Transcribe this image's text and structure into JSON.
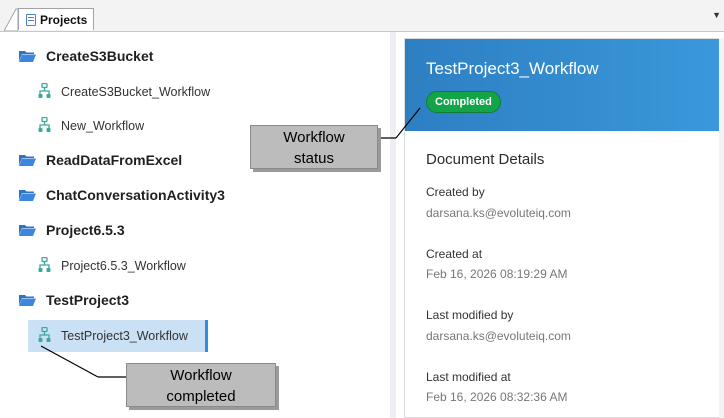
{
  "tabs": [
    {
      "label": "Projects"
    }
  ],
  "tree": {
    "items": [
      {
        "type": "folder",
        "label": "CreateS3Bucket"
      },
      {
        "type": "workflow",
        "label": "CreateS3Bucket_Workflow"
      },
      {
        "type": "workflow",
        "label": "New_Workflow"
      },
      {
        "type": "folder",
        "label": "ReadDataFromExcel"
      },
      {
        "type": "folder",
        "label": "ChatConversationActivity3"
      },
      {
        "type": "folder",
        "label": "Project6.5.3"
      },
      {
        "type": "workflow",
        "label": "Project6.5.3_Workflow"
      },
      {
        "type": "folder",
        "label": "TestProject3"
      },
      {
        "type": "workflow",
        "label": "TestProject3_Workflow",
        "selected": true
      }
    ]
  },
  "detail": {
    "title": "TestProject3_Workflow",
    "status": "Completed",
    "section_title": "Document Details",
    "fields": [
      {
        "label": "Created by",
        "value": "darsana.ks@evoluteiq.com"
      },
      {
        "label": "Created at",
        "value": "Feb 16, 2026 08:19:29 AM"
      },
      {
        "label": "Last modified by",
        "value": "darsana.ks@evoluteiq.com"
      },
      {
        "label": "Last modified at",
        "value": "Feb 16, 2026 08:32:36 AM"
      }
    ]
  },
  "callouts": {
    "status_line1": "Workflow",
    "status_line2": "status",
    "completed_line1": "Workflow",
    "completed_line2": "completed"
  },
  "colors": {
    "hero": "#2d7fc2",
    "badge": "#15a34a",
    "folder_icon": "#2f73c9",
    "workflow_icon": "#3aa89a",
    "selection": "#c9e0f5"
  },
  "icons": {
    "tab": "document-icon",
    "folder": "folder-open-icon",
    "workflow": "workflow-icon",
    "menu": "chevron-down-icon"
  }
}
